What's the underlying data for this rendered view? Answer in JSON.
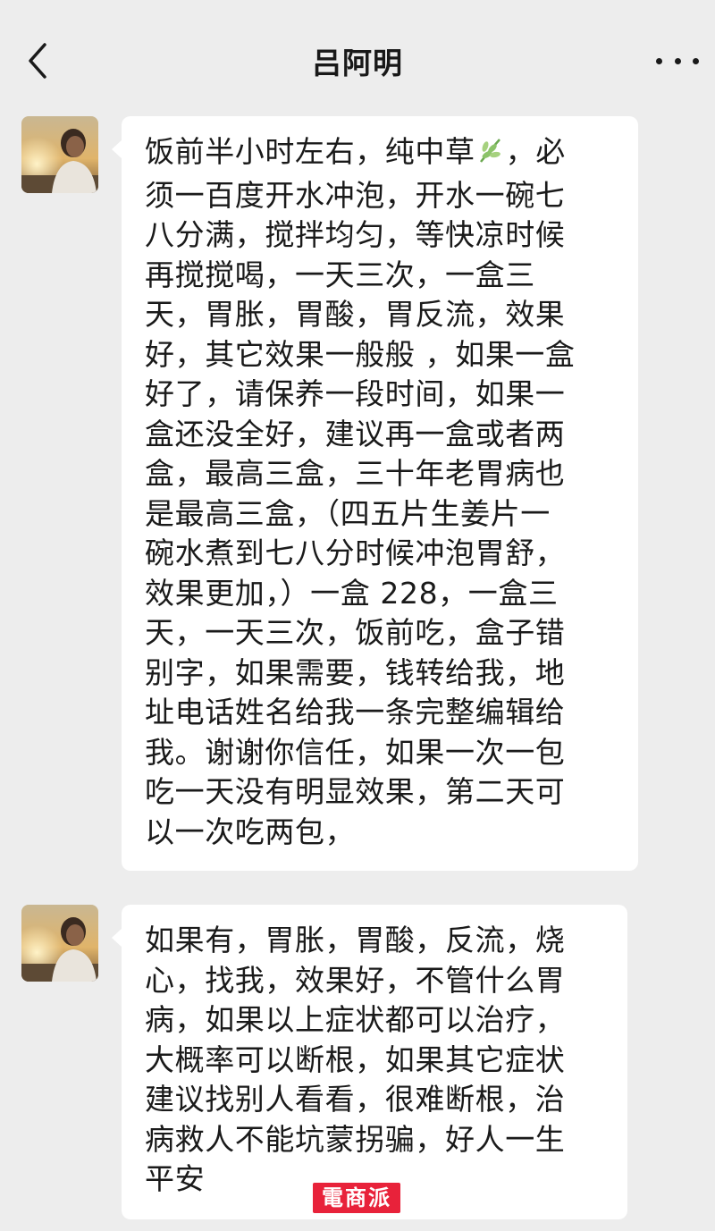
{
  "header": {
    "title": "吕阿明",
    "back_icon": "chevron-left-icon",
    "more_icon": "more-dots-icon"
  },
  "messages": [
    {
      "sender": "吕阿明",
      "lines_before_emoji": "饭前半小时左右，纯中草",
      "emoji_icon": "herb-leaf-icon",
      "lines": [
        "，必",
        "须一百度开水冲泡，开水一碗七",
        "八分满，搅拌均匀，等快凉时候",
        "再搅搅喝，一天三次，一盒三",
        "天，胃胀，胃酸，胃反流，效果",
        "好，其它效果一般般 ，如果一盒",
        "好了，请保养一段时间，如果一",
        "盒还没全好，建议再一盒或者两",
        "盒，最高三盒，三十年老胃病也",
        "是最高三盒，（四五片生姜片一",
        "碗水煮到七八分时候冲泡胃舒，",
        "效果更加，）一盒 228，一盒三",
        "天，一天三次，饭前吃，盒子错",
        "别字，如果需要，钱转给我，地",
        "址电话姓名给我一条完整编辑给",
        "我。谢谢你信任，如果一次一包",
        "吃一天没有明显效果，第二天可",
        "以一次吃两包，"
      ]
    },
    {
      "sender": "吕阿明",
      "lines": [
        "如果有，胃胀，胃酸，反流，烧",
        "心，找我，效果好，不管什么胃",
        "病，如果以上症状都可以治疗，",
        "大概率可以断根，如果其它症状",
        "建议找别人看看，很难断根，治",
        "病救人不能坑蒙拐骗，好人一生",
        "平安"
      ]
    }
  ],
  "watermark": {
    "text": "電商派",
    "color": "#e8223a"
  },
  "colors": {
    "background": "#ededed",
    "bubble": "#ffffff",
    "text": "#1a1a1a"
  }
}
